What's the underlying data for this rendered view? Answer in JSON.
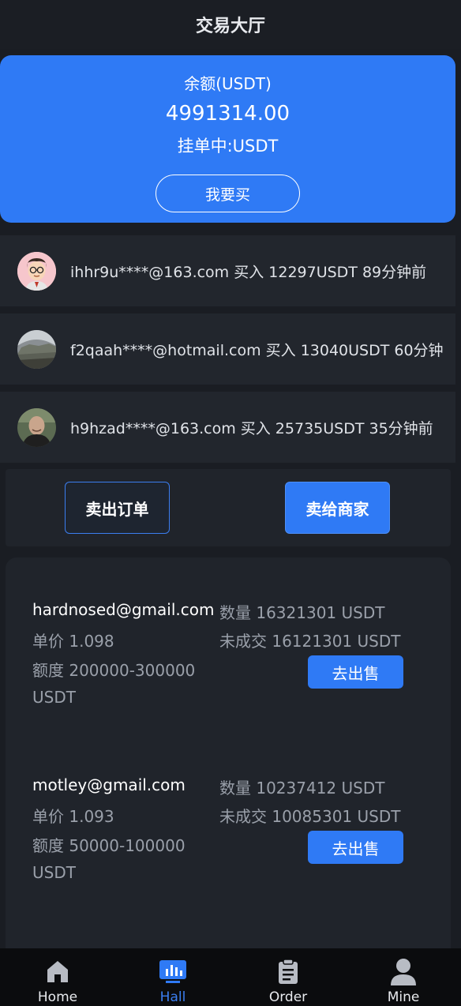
{
  "header": {
    "title": "交易大厅"
  },
  "balance": {
    "label": "余额(USDT)",
    "amount": "4991314.00",
    "pending": "挂单中:USDT",
    "buy_label": "我要买"
  },
  "feed": [
    {
      "text": "ihhr9u****@163.com 买入 12297USDT 89分钟前"
    },
    {
      "text": "f2qaah****@hotmail.com 买入 13040USDT 60分钟"
    },
    {
      "text": "h9hzad****@163.com 买入 25735USDT 35分钟前"
    }
  ],
  "actions": {
    "sell_orders": "卖出订单",
    "sell_to_merchant": "卖给商家"
  },
  "listings": [
    {
      "email": "hardnosed@gmail.com",
      "price": "单价 1.098",
      "limit": "额度 200000-300000 USDT",
      "quantity": "数量 16321301 USDT",
      "unfilled": "未成交 16121301 USDT",
      "button": "去出售"
    },
    {
      "email": "motley@gmail.com",
      "price": "单价 1.093",
      "limit": "额度 50000-100000 USDT",
      "quantity": "数量 10237412 USDT",
      "unfilled": "未成交 10085301 USDT",
      "button": "去出售"
    }
  ],
  "tabbar": {
    "items": [
      {
        "label": "Home",
        "icon": "home-icon"
      },
      {
        "label": "Hall",
        "icon": "chart-icon",
        "active": true
      },
      {
        "label": "Order",
        "icon": "clipboard-icon"
      },
      {
        "label": "Mine",
        "icon": "user-icon"
      }
    ]
  },
  "colors": {
    "accent": "#2f7af5",
    "background": "#1a1d23",
    "card": "#22262d",
    "tabbar": "#0b0c0e"
  }
}
